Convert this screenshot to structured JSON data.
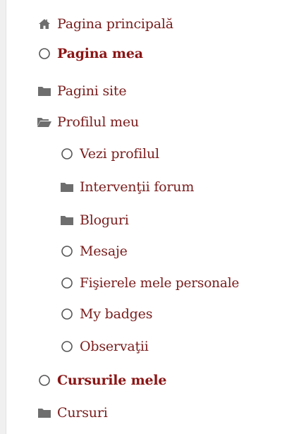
{
  "colors": {
    "link": "#7a1c1c",
    "link_bold": "#8b1515",
    "icon": "#6e6e6e",
    "left_rule": "#f0f0f0"
  },
  "nav": {
    "items": [
      {
        "label": "Pagina principală",
        "icon": "home-icon",
        "bold": false,
        "level": 0
      },
      {
        "label": "Pagina mea",
        "icon": "circle-icon",
        "bold": true,
        "level": 0
      },
      {
        "label": "Pagini site",
        "icon": "folder-icon",
        "bold": false,
        "level": 0
      },
      {
        "label": "Profilul meu",
        "icon": "folder-open-icon",
        "bold": false,
        "level": 0
      },
      {
        "label": "Vezi profilul",
        "icon": "circle-icon",
        "bold": false,
        "level": 1
      },
      {
        "label": "Intervenţii forum",
        "icon": "folder-icon",
        "bold": false,
        "level": 1
      },
      {
        "label": "Bloguri",
        "icon": "folder-icon",
        "bold": false,
        "level": 1
      },
      {
        "label": "Mesaje",
        "icon": "circle-icon",
        "bold": false,
        "level": 1
      },
      {
        "label": "Fişierele mele personale",
        "icon": "circle-icon",
        "bold": false,
        "level": 1
      },
      {
        "label": "My badges",
        "icon": "circle-icon",
        "bold": false,
        "level": 1
      },
      {
        "label": "Observaţii",
        "icon": "circle-icon",
        "bold": false,
        "level": 1
      },
      {
        "label": "Cursurile mele",
        "icon": "circle-icon",
        "bold": true,
        "level": 0
      },
      {
        "label": "Cursuri",
        "icon": "folder-icon",
        "bold": false,
        "level": 0
      }
    ]
  }
}
